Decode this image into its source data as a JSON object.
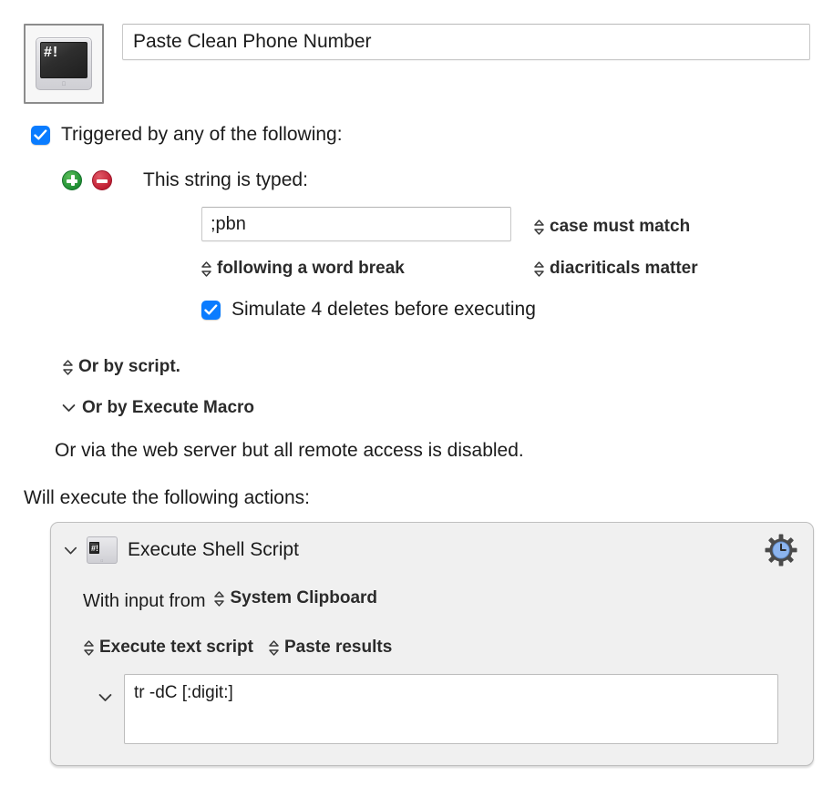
{
  "macro": {
    "icon_name": "shell-script-monitor-icon",
    "icon_glyph": "#!",
    "title": "Paste Clean Phone Number"
  },
  "trigger_section": {
    "enabled_label": "Triggered by any of the following:",
    "enabled_checked": "true",
    "add_button_name": "add-trigger-button",
    "remove_button_name": "remove-trigger-button",
    "typed_string_label": "This string is typed:",
    "typed_string_value": ";pbn",
    "case_option": "case must match",
    "word_break_option": "following a word break",
    "diacriticals_option": "diacriticals matter",
    "simulate_deletes_label": "Simulate 4 deletes before executing",
    "simulate_deletes_checked": "true",
    "or_by_script": "Or by script.",
    "or_by_execute_macro": "Or by Execute Macro",
    "web_server_note": "Or via the web server but all remote access is disabled."
  },
  "actions_section": {
    "heading": "Will execute the following actions:",
    "action": {
      "icon_name": "shell-script-monitor-icon",
      "icon_glyph": "#!",
      "title": "Execute Shell Script",
      "gear_icon_name": "gear-clock-icon",
      "input_prefix": "With input from",
      "input_source": "System Clipboard",
      "execute_mode": "Execute text script",
      "result_mode": "Paste results",
      "script_text": "tr -dC [:digit:]"
    }
  },
  "colors": {
    "accent_blue": "#0a7cff",
    "add_green": "#1f8f33",
    "remove_red": "#c01f33",
    "panel_background": "#f0f0f0",
    "clock_face_blue": "#8cb4ee"
  }
}
